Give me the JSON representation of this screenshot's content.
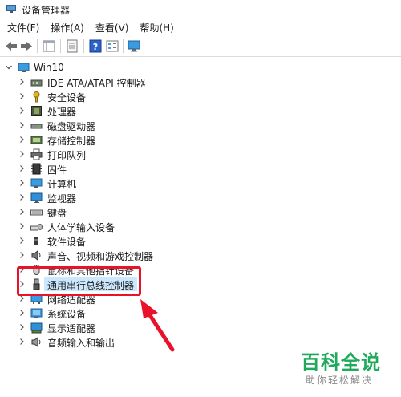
{
  "window": {
    "title": "设备管理器"
  },
  "menu": [
    {
      "label": "文件(F)"
    },
    {
      "label": "操作(A)"
    },
    {
      "label": "查看(V)"
    },
    {
      "label": "帮助(H)"
    }
  ],
  "tree": {
    "root": {
      "label": "Win10",
      "icon": "computer-icon"
    },
    "items": [
      {
        "label": "IDE ATA/ATAPI 控制器",
        "icon": "ide-controller-icon"
      },
      {
        "label": "安全设备",
        "icon": "security-key-icon"
      },
      {
        "label": "处理器",
        "icon": "processor-icon"
      },
      {
        "label": "磁盘驱动器",
        "icon": "disk-drive-icon"
      },
      {
        "label": "存储控制器",
        "icon": "storage-controller-icon"
      },
      {
        "label": "打印队列",
        "icon": "printer-icon"
      },
      {
        "label": "固件",
        "icon": "firmware-icon"
      },
      {
        "label": "计算机",
        "icon": "computer-icon"
      },
      {
        "label": "监视器",
        "icon": "monitor-icon"
      },
      {
        "label": "键盘",
        "icon": "keyboard-icon"
      },
      {
        "label": "人体学输入设备",
        "icon": "hid-icon"
      },
      {
        "label": "软件设备",
        "icon": "software-device-icon"
      },
      {
        "label": "声音、视频和游戏控制器",
        "icon": "sound-icon"
      },
      {
        "label": "鼠标和其他指针设备",
        "icon": "mouse-icon"
      },
      {
        "label": "通用串行总线控制器",
        "icon": "usb-icon",
        "selected": true
      },
      {
        "label": "网络适配器",
        "icon": "network-adapter-icon"
      },
      {
        "label": "系统设备",
        "icon": "system-device-icon"
      },
      {
        "label": "显示适配器",
        "icon": "display-adapter-icon"
      },
      {
        "label": "音频输入和输出",
        "icon": "audio-io-icon"
      }
    ]
  },
  "watermark": {
    "main": "百科全说",
    "sub": "助你轻松解决"
  },
  "colors": {
    "highlight": "#e8122a",
    "selection": "#cce8ff",
    "brand": "#1eaa5a"
  }
}
